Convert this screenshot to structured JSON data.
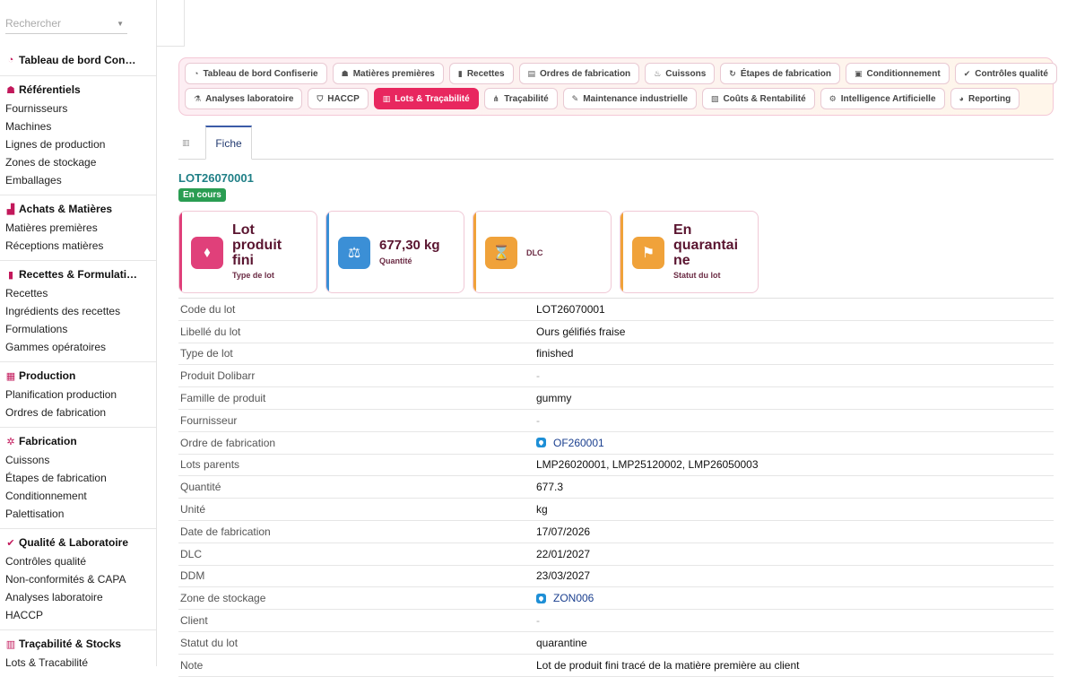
{
  "search": {
    "placeholder": "Rechercher"
  },
  "sidebar": {
    "groups": [
      {
        "title": "Tableau de bord Con…",
        "icon": "gauge-icon",
        "items": []
      },
      {
        "title": "Référentiels",
        "icon": "sitemap-icon",
        "items": [
          "Fournisseurs",
          "Machines",
          "Lignes de production",
          "Zones de stockage",
          "Emballages"
        ]
      },
      {
        "title": "Achats & Matières",
        "icon": "industry-icon",
        "items": [
          "Matières premières",
          "Réceptions matières"
        ]
      },
      {
        "title": "Recettes & Formulati…",
        "icon": "book-icon",
        "items": [
          "Recettes",
          "Ingrédients des recettes",
          "Formulations",
          "Gammes opératoires"
        ]
      },
      {
        "title": "Production",
        "icon": "calendar-icon",
        "items": [
          "Planification production",
          "Ordres de fabrication"
        ]
      },
      {
        "title": "Fabrication",
        "icon": "cogs-icon",
        "items": [
          "Cuissons",
          "Étapes de fabrication",
          "Conditionnement",
          "Palettisation"
        ]
      },
      {
        "title": "Qualité & Laboratoire",
        "icon": "check-circle-icon",
        "items": [
          "Contrôles qualité",
          "Non-conformités & CAPA",
          "Analyses laboratoire",
          "HACCP"
        ]
      },
      {
        "title": "Traçabilité & Stocks",
        "icon": "barcode-icon",
        "items": [
          "Lots & Traçabilité"
        ]
      }
    ]
  },
  "modules": {
    "row1": [
      {
        "label": "Tableau de bord Confiserie",
        "icon": "gauge-icon"
      },
      {
        "label": "Matières premières",
        "icon": "sitemap-icon"
      },
      {
        "label": "Recettes",
        "icon": "book-icon"
      },
      {
        "label": "Ordres de fabrication",
        "icon": "clipboard-icon"
      },
      {
        "label": "Cuissons",
        "icon": "fire-icon"
      },
      {
        "label": "Étapes de fabrication",
        "icon": "sync-icon"
      },
      {
        "label": "Conditionnement",
        "icon": "box-icon"
      },
      {
        "label": "Contrôles qualité",
        "icon": "check-circle-icon"
      }
    ],
    "row2": [
      {
        "label": "Analyses laboratoire",
        "icon": "microscope-icon"
      },
      {
        "label": "HACCP",
        "icon": "shield-icon"
      },
      {
        "label": "Lots & Traçabilité",
        "icon": "barcode-icon",
        "active": true
      },
      {
        "label": "Traçabilité",
        "icon": "project-diagram-icon"
      },
      {
        "label": "Maintenance industrielle",
        "icon": "wrench-icon"
      },
      {
        "label": "Coûts & Rentabilité",
        "icon": "money-icon"
      },
      {
        "label": "Intelligence Artificielle",
        "icon": "robot-icon"
      },
      {
        "label": "Reporting",
        "icon": "pie-chart-icon"
      }
    ]
  },
  "tabs": {
    "fiche": "Fiche"
  },
  "lot": {
    "ref": "LOT26070001",
    "status": "En cours",
    "status_color": "#2a9d52"
  },
  "kpis": [
    {
      "value_lines": [
        "Lot",
        "produit",
        "fini"
      ],
      "label": "Type de lot",
      "icon": "tags-icon",
      "color": "#e0407a"
    },
    {
      "value_lines": [
        "677,30 kg"
      ],
      "label": "Quantité",
      "icon": "balance-scale-icon",
      "color": "#3b8fd6"
    },
    {
      "value_lines": [],
      "label": "DLC",
      "icon": "hourglass-icon",
      "color": "#f0a23a"
    },
    {
      "value_lines": [
        "En",
        "quarantai",
        "ne"
      ],
      "label": "Statut du lot",
      "icon": "flag-icon",
      "color": "#f0a23a"
    }
  ],
  "fields": [
    {
      "label": "Code du lot",
      "value": "LOT26070001"
    },
    {
      "label": "Libellé du lot",
      "value": "Ours gélifiés fraise"
    },
    {
      "label": "Type de lot",
      "value": "finished"
    },
    {
      "label": "Produit Dolibarr",
      "value": "-"
    },
    {
      "label": "Famille de produit",
      "value": "gummy"
    },
    {
      "label": "Fournisseur",
      "value": "-"
    },
    {
      "label": "Ordre de fabrication",
      "value": "OF260001",
      "link": true
    },
    {
      "label": "Lots parents",
      "value": "LMP26020001, LMP25120002, LMP26050003"
    },
    {
      "label": "Quantité",
      "value": "677.3"
    },
    {
      "label": "Unité",
      "value": "kg"
    },
    {
      "label": "Date de fabrication",
      "value": "17/07/2026"
    },
    {
      "label": "DLC",
      "value": "22/01/2027"
    },
    {
      "label": "DDM",
      "value": "23/03/2027"
    },
    {
      "label": "Zone de stockage",
      "value": "ZON006",
      "link": true
    },
    {
      "label": "Client",
      "value": "-"
    },
    {
      "label": "Statut du lot",
      "value": "quarantine"
    },
    {
      "label": "Note",
      "value": "Lot de produit fini tracé de la matière première au client"
    }
  ]
}
